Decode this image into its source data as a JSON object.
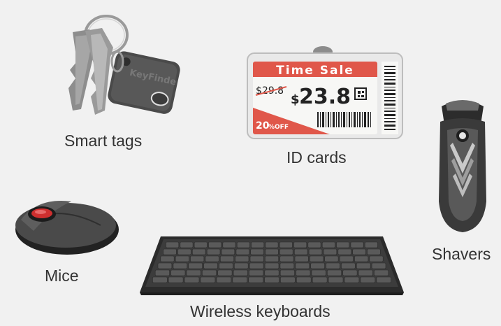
{
  "products": [
    {
      "id": "smart-tags",
      "label": "Smart tags",
      "image_text": "KeyFinde"
    },
    {
      "id": "id-cards",
      "label": "ID cards"
    },
    {
      "id": "shavers",
      "label": "Shavers"
    },
    {
      "id": "mice",
      "label": "Mice"
    },
    {
      "id": "wireless-keyboards",
      "label": "Wireless keyboards"
    }
  ],
  "esl_tag": {
    "banner": "Time Sale",
    "old_price": "$29.8",
    "currency": "$",
    "new_price": "23.8",
    "discount_number": "20",
    "discount_suffix": "%OFF"
  },
  "colors": {
    "background": "#f1f1f1",
    "label_text": "#333333",
    "tag_red": "#e0574a",
    "device_dark": "#3a3a3a"
  }
}
